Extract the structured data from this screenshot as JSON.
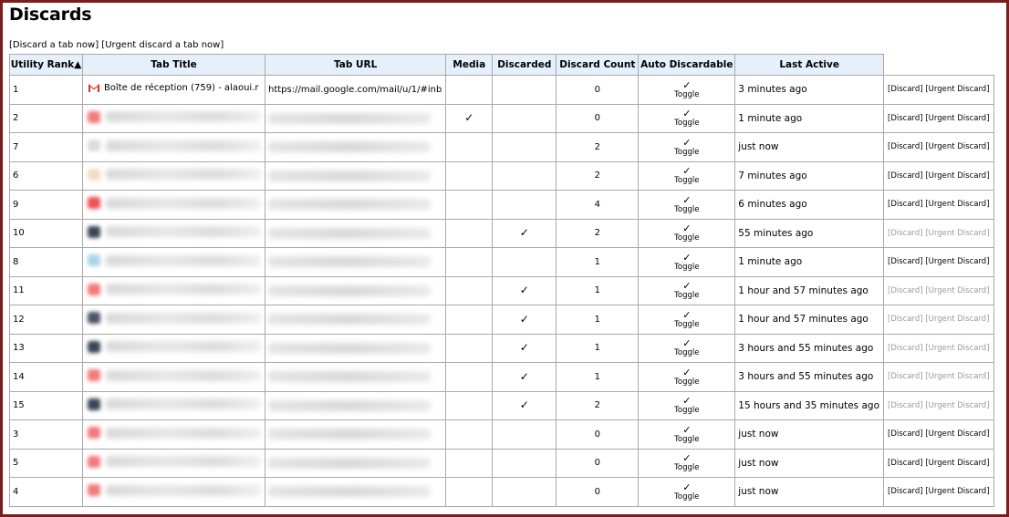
{
  "page_title": "Discards",
  "top_links": {
    "discard_now": "[Discard a tab now]",
    "urgent_discard_now": "[Urgent discard a tab now]"
  },
  "columns": [
    "Utility Rank▲",
    "Tab Title",
    "Tab URL",
    "Media",
    "Discarded",
    "Discard Count",
    "Auto Discardable",
    "Last Active"
  ],
  "action_labels": {
    "discard": "[Discard]",
    "urgent": "[Urgent Discard]",
    "toggle": "Toggle",
    "check": "✓"
  },
  "colors": {
    "header_bg": "#e6f0fb",
    "frame": "#7b1d1d",
    "border": "#a9a9a9",
    "dim_text": "#9a9a9a",
    "gmail_red": "#d93025"
  },
  "rows": [
    {
      "rank": "1",
      "title": "Boîte de réception (759) - alaoui.r",
      "url": "https://mail.google.com/mail/u/1/#inb",
      "media": "",
      "discarded": "",
      "count": "0",
      "auto": "✓",
      "last": "3 minutes ago",
      "dim": false,
      "icon": "gmail-icon",
      "favcolor": ""
    },
    {
      "rank": "2",
      "title": "",
      "url": "",
      "media": "✓",
      "discarded": "",
      "count": "0",
      "auto": "✓",
      "last": "1 minute ago",
      "dim": false,
      "icon": "favicon",
      "favcolor": "#f47a7a"
    },
    {
      "rank": "7",
      "title": "",
      "url": "",
      "media": "",
      "discarded": "",
      "count": "2",
      "auto": "✓",
      "last": "just now",
      "dim": false,
      "icon": "favicon",
      "favcolor": "#dddddd"
    },
    {
      "rank": "6",
      "title": "",
      "url": "",
      "media": "",
      "discarded": "",
      "count": "2",
      "auto": "✓",
      "last": "7 minutes ago",
      "dim": false,
      "icon": "favicon",
      "favcolor": "#f3dcc4"
    },
    {
      "rank": "9",
      "title": "",
      "url": "",
      "media": "",
      "discarded": "",
      "count": "4",
      "auto": "✓",
      "last": "6 minutes ago",
      "dim": false,
      "icon": "favicon",
      "favcolor": "#ef5050"
    },
    {
      "rank": "10",
      "title": "",
      "url": "",
      "media": "",
      "discarded": "✓",
      "count": "2",
      "auto": "✓",
      "last": "55 minutes ago",
      "dim": true,
      "icon": "favicon",
      "favcolor": "#3a4556"
    },
    {
      "rank": "8",
      "title": "",
      "url": "",
      "media": "",
      "discarded": "",
      "count": "1",
      "auto": "✓",
      "last": "1 minute ago",
      "dim": false,
      "icon": "favicon",
      "favcolor": "#a9d6ea"
    },
    {
      "rank": "11",
      "title": "",
      "url": "",
      "media": "",
      "discarded": "✓",
      "count": "1",
      "auto": "✓",
      "last": "1 hour and 57 minutes ago",
      "dim": true,
      "icon": "favicon",
      "favcolor": "#f47a7a"
    },
    {
      "rank": "12",
      "title": "",
      "url": "",
      "media": "",
      "discarded": "✓",
      "count": "1",
      "auto": "✓",
      "last": "1 hour and 57 minutes ago",
      "dim": true,
      "icon": "favicon",
      "favcolor": "#4b5566"
    },
    {
      "rank": "13",
      "title": "",
      "url": "",
      "media": "",
      "discarded": "✓",
      "count": "1",
      "auto": "✓",
      "last": "3 hours and 55 minutes ago",
      "dim": true,
      "icon": "favicon",
      "favcolor": "#3a4556"
    },
    {
      "rank": "14",
      "title": "",
      "url": "",
      "media": "",
      "discarded": "✓",
      "count": "1",
      "auto": "✓",
      "last": "3 hours and 55 minutes ago",
      "dim": true,
      "icon": "favicon",
      "favcolor": "#f47a7a"
    },
    {
      "rank": "15",
      "title": "",
      "url": "",
      "media": "",
      "discarded": "✓",
      "count": "2",
      "auto": "✓",
      "last": "15 hours and 35 minutes ago",
      "dim": true,
      "icon": "favicon",
      "favcolor": "#3a4556"
    },
    {
      "rank": "3",
      "title": "",
      "url": "",
      "media": "",
      "discarded": "",
      "count": "0",
      "auto": "✓",
      "last": "just now",
      "dim": false,
      "icon": "favicon",
      "favcolor": "#f47a7a"
    },
    {
      "rank": "5",
      "title": "",
      "url": "",
      "media": "",
      "discarded": "",
      "count": "0",
      "auto": "✓",
      "last": "just now",
      "dim": false,
      "icon": "favicon",
      "favcolor": "#f47a7a"
    },
    {
      "rank": "4",
      "title": "",
      "url": "",
      "media": "",
      "discarded": "",
      "count": "0",
      "auto": "✓",
      "last": "just now",
      "dim": false,
      "icon": "favicon",
      "favcolor": "#f47a7a"
    }
  ]
}
